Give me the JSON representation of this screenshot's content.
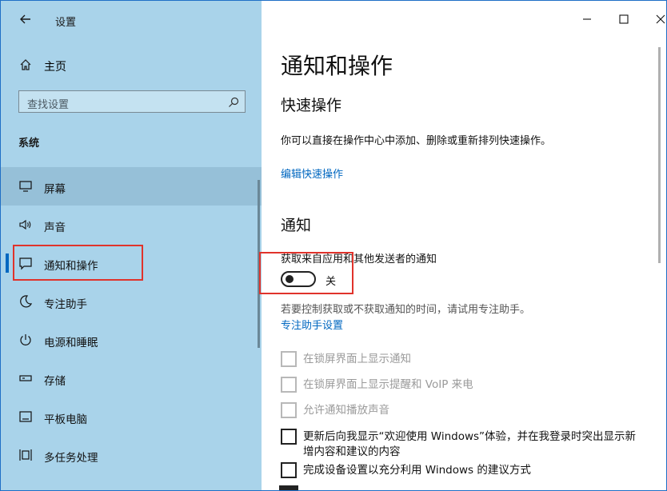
{
  "window": {
    "title": "设置"
  },
  "sidebar": {
    "home_label": "主页",
    "search_placeholder": "查找设置",
    "section_title": "系统",
    "items": [
      {
        "label": "屏幕",
        "icon": "monitor-icon"
      },
      {
        "label": "声音",
        "icon": "speaker-icon"
      },
      {
        "label": "通知和操作",
        "icon": "notification-icon"
      },
      {
        "label": "专注助手",
        "icon": "moon-icon"
      },
      {
        "label": "电源和睡眠",
        "icon": "power-icon"
      },
      {
        "label": "存储",
        "icon": "storage-icon"
      },
      {
        "label": "平板电脑",
        "icon": "tablet-icon"
      },
      {
        "label": "多任务处理",
        "icon": "multitask-icon"
      }
    ]
  },
  "main": {
    "title": "通知和操作",
    "quick_actions": {
      "heading": "快速操作",
      "description": "你可以直接在操作中心中添加、删除或重新排列快速操作。",
      "edit_link": "编辑快速操作"
    },
    "notifications": {
      "heading": "通知",
      "toggle_label": "获取来自应用和其他发送者的通知",
      "toggle_state": "关",
      "hint": "若要控制获取或不获取通知的时间，请试用专注助手。",
      "focus_link": "专注助手设置",
      "options": [
        {
          "label": "在锁屏界面上显示通知",
          "checked": false,
          "disabled": true
        },
        {
          "label": "在锁屏界面上显示提醒和 VoIP 来电",
          "checked": false,
          "disabled": true
        },
        {
          "label": "允许通知播放声音",
          "checked": false,
          "disabled": true
        },
        {
          "label": "更新后向我显示“欢迎使用 Windows”体验，并在我登录时突出显示新增内容和建议的内容",
          "checked": false,
          "disabled": false
        },
        {
          "label": "完成设备设置以充分利用 Windows 的建议方式",
          "checked": false,
          "disabled": false
        }
      ]
    }
  },
  "colors": {
    "accent": "#0067c0",
    "sidebar_bg": "#a9d3ea",
    "highlight": "#e0332b"
  }
}
